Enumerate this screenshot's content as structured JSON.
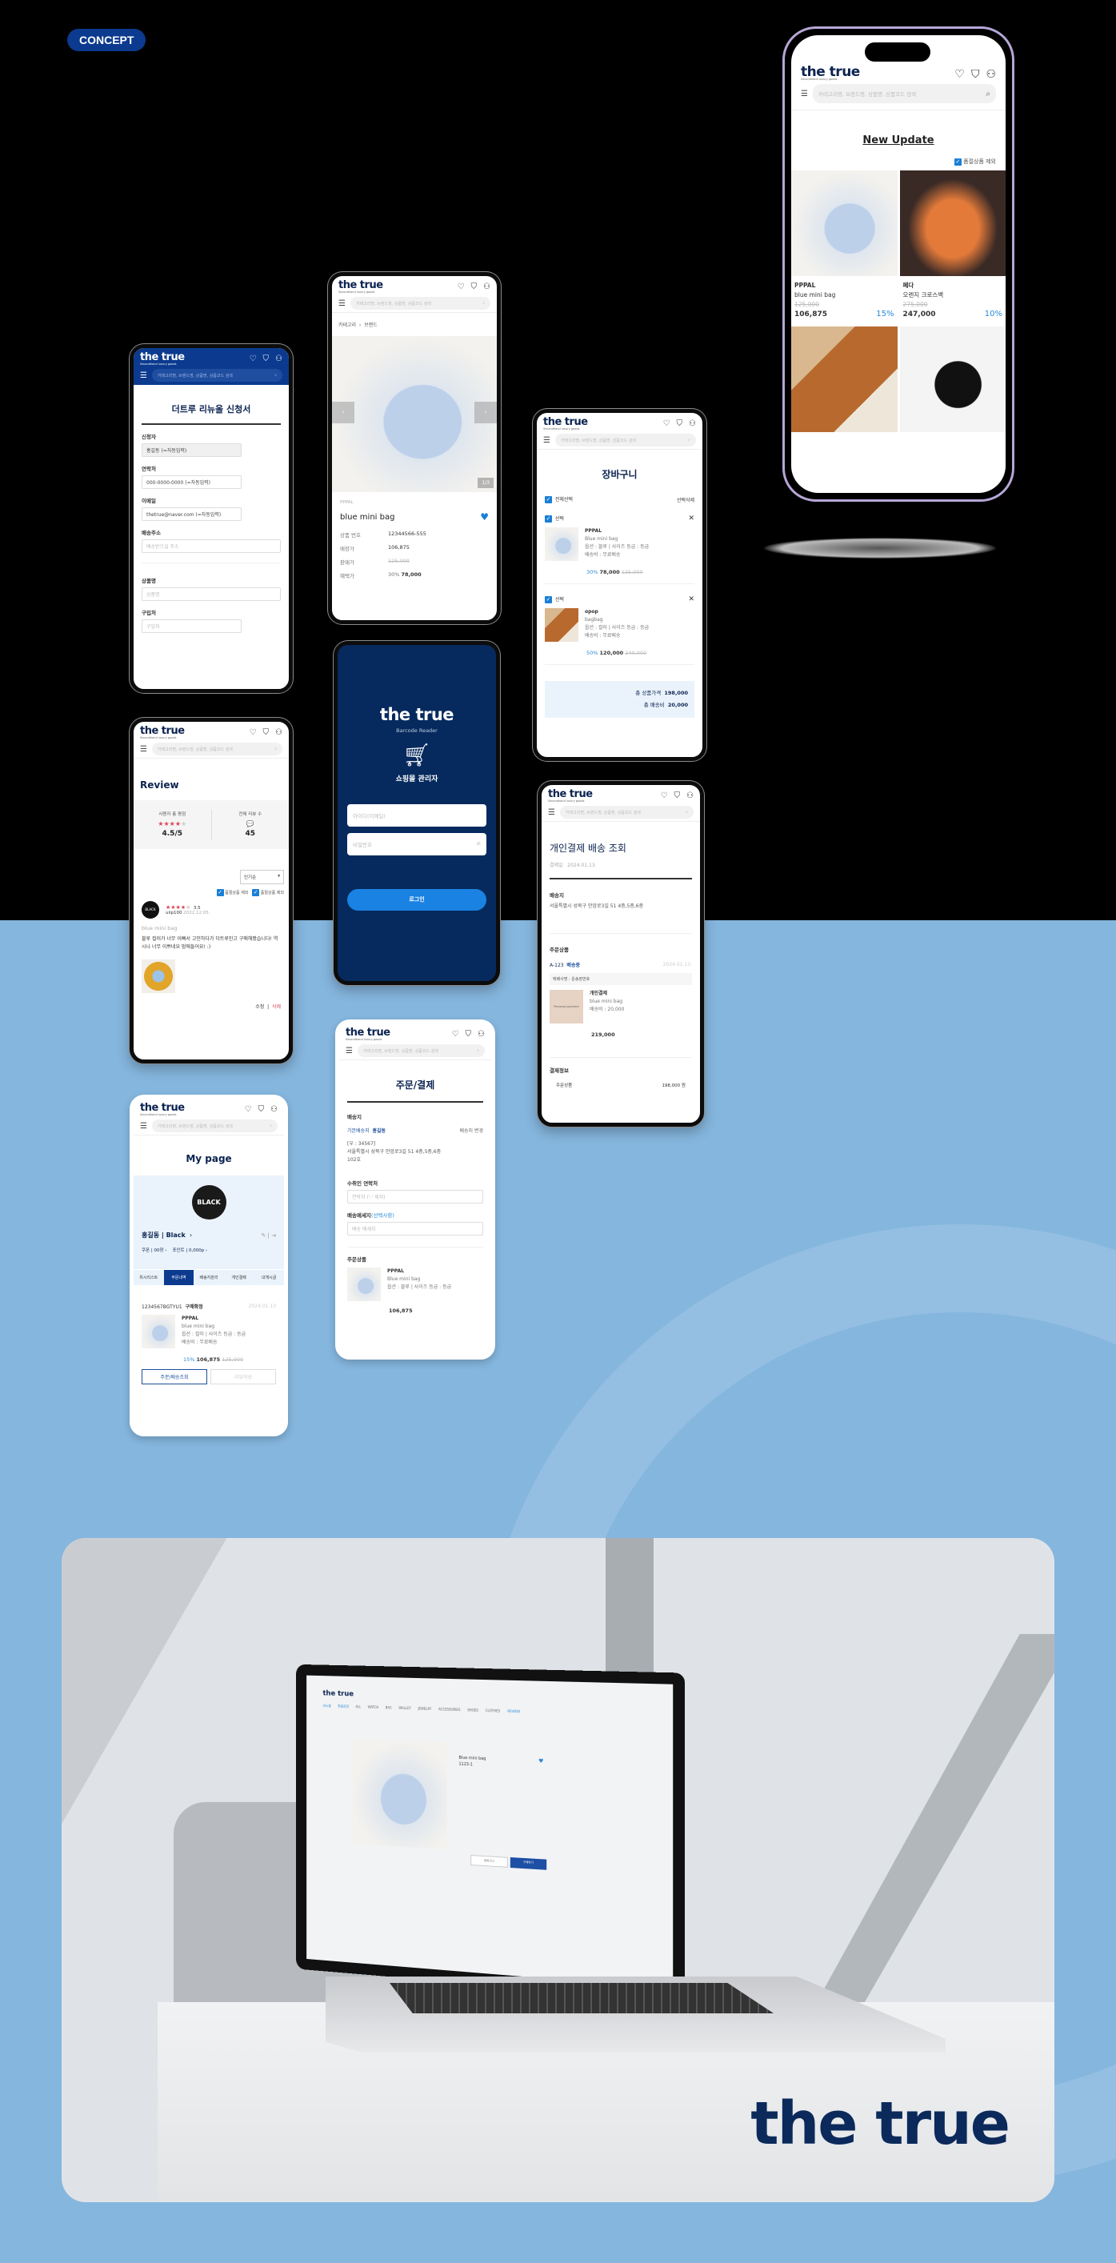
{
  "concept": {
    "badge": "CONCEPT"
  },
  "header": {
    "logo": "the true",
    "tagline": "Secondhand luxury goods",
    "search_placeholder": "카테고리명, 브랜드명, 상품명, 상품코드 검색"
  },
  "home": {
    "title": "New Update",
    "exclude_soldout": "품절상품 제외",
    "products": [
      {
        "brand": "PPPAL",
        "name": "blue mini bag",
        "original": "125,000",
        "price": "106,875",
        "discount": "15%"
      },
      {
        "brand": "페다",
        "name": "오렌지 크로스백",
        "original": "275,000",
        "price": "247,000",
        "discount": "10%"
      }
    ]
  },
  "application": {
    "title": "더트루 리뉴올 신청서",
    "fields": [
      {
        "label": "신청자",
        "value": "홍길동 (=자동입력)"
      },
      {
        "label": "연락처",
        "value": "000-0000-0000 (=자동입력)"
      },
      {
        "label": "이메일",
        "value": "thetrue@naver.com (=자동입력)"
      },
      {
        "label": "배송주소",
        "placeholder": "배송받으실 주소"
      },
      {
        "label": "상품명",
        "placeholder": "상품명"
      },
      {
        "label": "구입처",
        "placeholder": "구입처"
      }
    ]
  },
  "product": {
    "breadcrumb": [
      "카테고리",
      "브랜드"
    ],
    "counter": "1/3",
    "brand": "PPPAL",
    "name": "blue mini bag",
    "rows": [
      {
        "label": "상품 번호",
        "value": "12344566-555"
      },
      {
        "label": "매장가",
        "value": "106,875"
      },
      {
        "label": "판매가",
        "value": "125,000"
      }
    ],
    "benefit_label": "혜택가",
    "benefit_discount": "30%",
    "benefit_price": "78,000"
  },
  "cart": {
    "title": "장바구니",
    "select_all": "전체선택",
    "delete_selected": "선택삭제",
    "select": "선택",
    "items": [
      {
        "brand": "PPPAL",
        "name": "Blue mini bag",
        "option": "옵션 : 블루 | 사이즈  등급 : 등급",
        "shipping": "배송비 : 무료배송",
        "discount": "30%",
        "price": "78,000",
        "original": "125,000"
      },
      {
        "brand": "opop",
        "name": "bagbag",
        "option": "옵션 : 컬러 | 사이즈  등급 : 등급",
        "shipping": "배송비 : 무료배송",
        "discount": "50%",
        "price": "120,000",
        "original": "240,000"
      }
    ],
    "total_label": "총 상품가격",
    "total": "198,000",
    "ship_label": "총 배송비",
    "ship": "20,000"
  },
  "review": {
    "title": "Review",
    "rating_label": "사용자 총 평점",
    "rating": "4.5/5",
    "count_label": "전체 리뷰 수",
    "count": "45",
    "sort": "인기순",
    "filters": [
      "품절상품 제외",
      "품절상품 제외"
    ],
    "entry": {
      "avatar": "BLACK",
      "score": "3.5",
      "user": "uiip100",
      "date": "2022.12.05.",
      "product": "blue mini bag",
      "text": "블루 컬러가 너무 이뻐서 고민하다가 더트루인고 구매해봤습니다! 역시나 너무 이쁘네요 맘에들어요! :)",
      "edit": "수정",
      "delete": "삭제"
    }
  },
  "login": {
    "logo": "the true",
    "subtitle": "Barcode Reader",
    "heading": "쇼핑몰 관리자",
    "id_placeholder": "아이디(이메일)",
    "pw_placeholder": "비밀번호",
    "button": "로그인",
    "button_color": "#1a82e2",
    "bg_color": "#062a5e"
  },
  "delivery": {
    "title": "개인결제 배송 조회",
    "date_label": "결제일",
    "date": "2024.01.13.",
    "address_label": "배송지",
    "address": "서울특별시 성북구 안암로3길 51 4층,5층,6층",
    "items_label": "주문상품",
    "order_no": "A-123",
    "status": "배송중",
    "order_date": "2024.01.13.",
    "courier": "택배사명 : 운송장번호",
    "thumb_text": "Personal payment",
    "item_title": "개인결제",
    "item_name": "blue mini bag",
    "item_ship": "배송비 : 20,000",
    "item_price": "219,000",
    "pay_label": "결제정보",
    "pay_row_label": "주문상품",
    "pay_row_value": "198,000 원"
  },
  "order": {
    "title": "주문/결제",
    "address_label": "배송지",
    "default_label": "기본배송지",
    "recipient": "홍길동",
    "change": "배송지 변경",
    "zip": "[우 : 34567]",
    "address": "서울특별시 성북구 안암로3길 51 4층,5층,6층",
    "address2": "102호",
    "phone_label": "수취인 연락처",
    "phone_placeholder": "연락처 ('-' 제외)",
    "msg_label": "배송메세지",
    "msg_optional": "(선택사항)",
    "msg_placeholder": "배송 메세지",
    "items_label": "주문상품",
    "item": {
      "brand": "PPPAL",
      "name": "Blue mini bag",
      "option": "옵션 : 블루 | 사이즈  등급 : 등급",
      "price": "106,875"
    }
  },
  "mypage": {
    "title": "My page",
    "grade": "BLACK",
    "user": "홍길동 | Black",
    "coupon": "쿠폰 | 00장",
    "point": "포인트 | 0,000p",
    "tabs": [
      "위시리스트",
      "주문내역",
      "배송지관리",
      "개인결제",
      "내게시글"
    ],
    "active_tab": 1,
    "order": {
      "no": "1234567BGTYU1",
      "status": "구매확정",
      "date": "2024.01.13",
      "brand": "PPPAL",
      "name": "blue mini bag",
      "option": "옵션 : 컬러 | 사이즈  등급 : 등급",
      "shipping": "배송비 : 무료배송",
      "discount": "15%",
      "price": "106,875",
      "original": "125,000"
    },
    "btn_track": "주문/배송조회",
    "btn_review": "리뷰작성"
  },
  "laptop": {
    "logo": "the true",
    "subnav": [
      "리뉴올",
      "명품감정"
    ],
    "nav": [
      "ALL",
      "WATCH",
      "BAG",
      "WALLET",
      "JEWELRY",
      "ACCESSORIES",
      "SHOES",
      "CLOTHES",
      "REVIEW"
    ],
    "product_name": "Blue mini bag",
    "product_code": "1123-1",
    "cart": "장바구니",
    "buy": "구매하기"
  },
  "brand": {
    "wordmark": "the true",
    "color": "#0b2a5b"
  }
}
